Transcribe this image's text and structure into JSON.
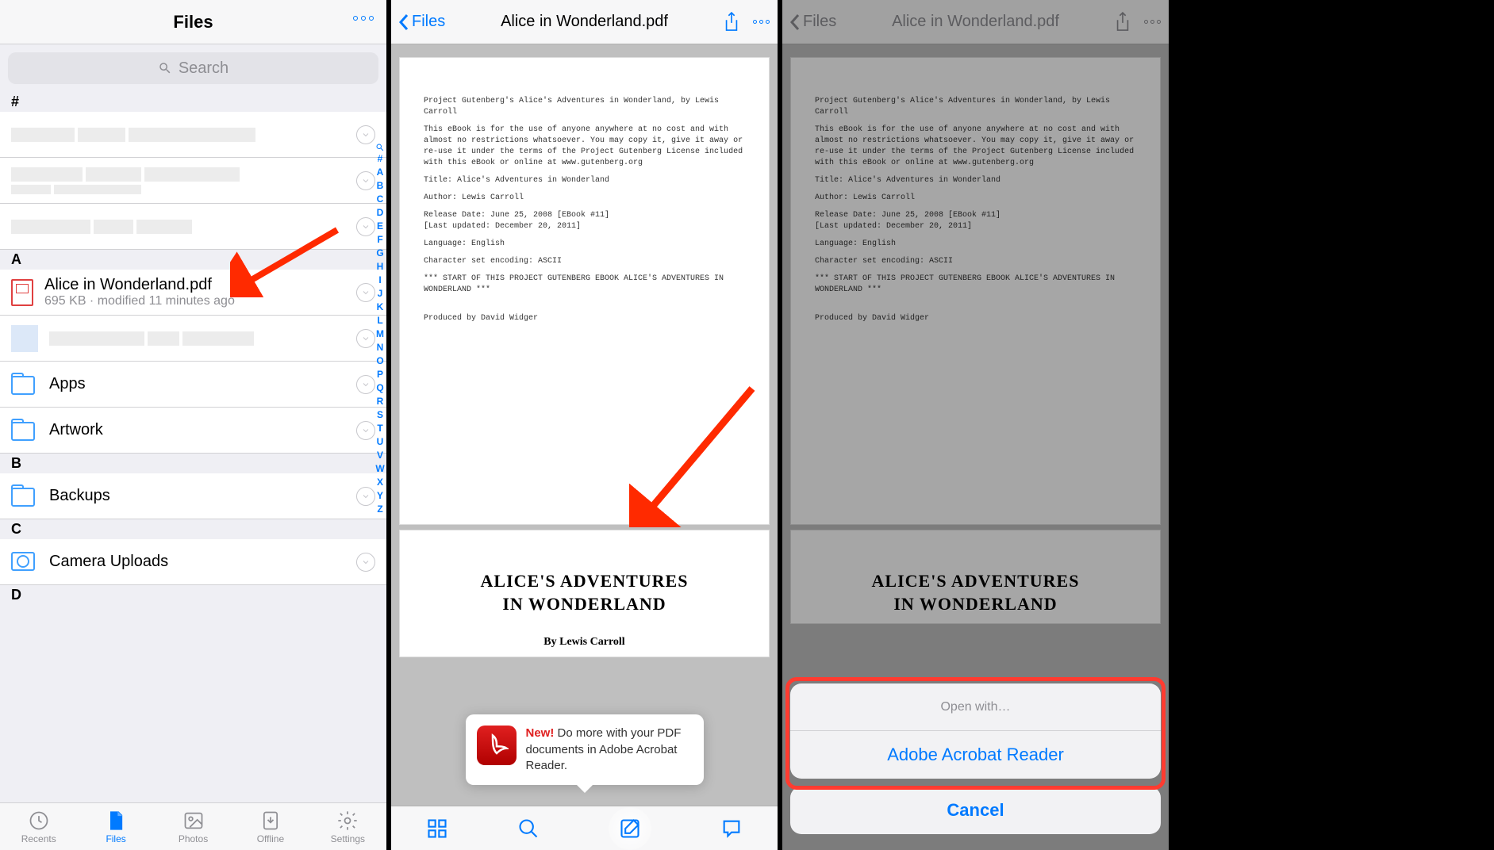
{
  "screen1": {
    "title": "Files",
    "search_placeholder": "Search",
    "sections": {
      "hash": "#",
      "a": "A",
      "b": "B",
      "c": "C",
      "d": "D"
    },
    "alice": {
      "name": "Alice in Wonderland.pdf",
      "meta": "695 KB · modified 11 minutes ago"
    },
    "folders": {
      "apps": "Apps",
      "artwork": "Artwork",
      "backups": "Backups",
      "camera": "Camera Uploads"
    },
    "index": [
      "#",
      "A",
      "B",
      "C",
      "D",
      "E",
      "F",
      "G",
      "H",
      "I",
      "J",
      "K",
      "L",
      "M",
      "N",
      "O",
      "P",
      "Q",
      "R",
      "S",
      "T",
      "U",
      "V",
      "W",
      "X",
      "Y",
      "Z"
    ],
    "tabs": {
      "recents": "Recents",
      "files": "Files",
      "photos": "Photos",
      "offline": "Offline",
      "settings": "Settings"
    }
  },
  "pdf": {
    "back": "Files",
    "title": "Alice in Wonderland.pdf",
    "line1": "Project Gutenberg's Alice's Adventures in Wonderland, by Lewis Carroll",
    "line2": "This eBook is for the use of anyone anywhere at no cost and with almost no restrictions whatsoever.  You may copy it, give it away or re-use it under the terms of the Project Gutenberg License included with this eBook or online at www.gutenberg.org",
    "line3": "Title: Alice's Adventures in Wonderland",
    "line4": "Author: Lewis Carroll",
    "line5": "Release Date: June 25, 2008 [EBook #11]",
    "line5b": "[Last updated: December 20, 2011]",
    "line6": "Language: English",
    "line7": "Character set encoding: ASCII",
    "line8": "*** START OF THIS PROJECT GUTENBERG EBOOK ALICE'S ADVENTURES IN WONDERLAND ***",
    "line9": "Produced by David Widger",
    "big_title1": "ALICE'S ADVENTURES",
    "big_title2": "IN WONDERLAND",
    "author": "By Lewis Carroll"
  },
  "tooltip": {
    "new": "New!",
    "text": " Do more with your PDF documents in Adobe Acrobat Reader."
  },
  "sheet": {
    "title": "Open with…",
    "action": "Adobe Acrobat Reader",
    "cancel": "Cancel"
  }
}
